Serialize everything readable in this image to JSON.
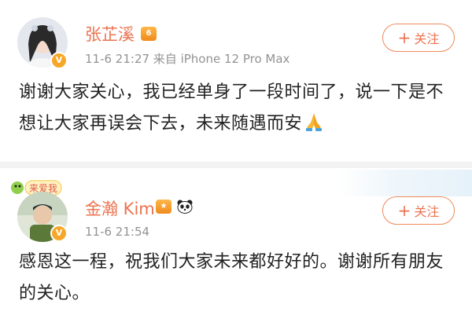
{
  "posts": [
    {
      "username": "张芷溪",
      "meta": "11-6 21:27  来自 iPhone 12 Pro Max",
      "follow_label": "关注",
      "content": "谢谢大家关心，我已经单身了一段时间了，说一下是不想让大家再误会下去，未来随遇而安",
      "emoji": "folded-hands-icon"
    },
    {
      "username": "金瀚 Kim",
      "meta": "11-6 21:54",
      "follow_label": "关注",
      "content": "感恩这一程，祝我们大家未来都好好的。谢谢所有朋友的关心。",
      "sticker_text": "来爱我"
    }
  ],
  "colors": {
    "accent": "#eb7350",
    "verified": "#f7a728",
    "meta": "#939393",
    "text": "#222222"
  }
}
